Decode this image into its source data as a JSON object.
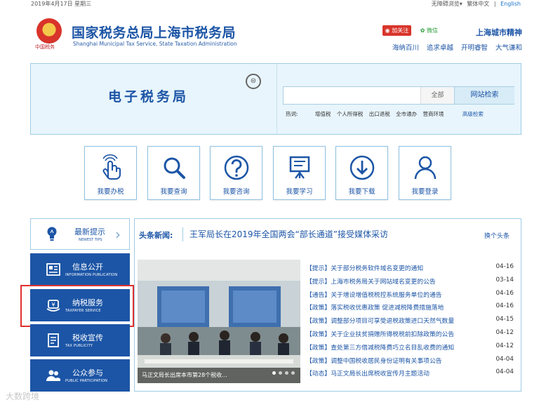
{
  "topbar": {
    "date": "2019年4月17日 星期三",
    "accessibility": "无障碍浏览▾",
    "traditional": "繁体中文",
    "divider": "|",
    "english": "English"
  },
  "header": {
    "title": "国家税务总局上海市税务局",
    "subtitle": "Shanghai Municipal Tax Service, State Taxation Administration",
    "emblem_caption": "中国税务",
    "weibo_label": "加关注",
    "wechat_label": "微信",
    "city_spirit": "上海城市精神",
    "mottos": [
      "海纳百川",
      "追求卓越",
      "开明睿智",
      "大气谦和"
    ]
  },
  "etax": {
    "title": "电子税务局",
    "search_placeholder": "",
    "scope": "全部",
    "search_button": "网站检索",
    "hotwords_label": "热词:",
    "hotwords": [
      "增值税",
      "个人所得税",
      "出口退税",
      "全市通办",
      "营商环境"
    ],
    "advanced": "高级检索"
  },
  "quick_links": [
    {
      "label": "我要办税",
      "icon": "hand-pointer-icon"
    },
    {
      "label": "我要查询",
      "icon": "search-icon"
    },
    {
      "label": "我要咨询",
      "icon": "question-icon"
    },
    {
      "label": "我要学习",
      "icon": "easel-icon"
    },
    {
      "label": "我要下载",
      "icon": "download-icon"
    },
    {
      "label": "我要登录",
      "icon": "user-icon"
    }
  ],
  "sidebar": {
    "newest_title": "最新提示",
    "newest_sub": "NEWEST TIPS",
    "items": [
      {
        "label": "信息公开",
        "sub": "INFORMATION PUBLICATION",
        "icon": "newspaper-icon"
      },
      {
        "label": "纳税服务",
        "sub": "TAXPAYER SERVICE",
        "icon": "service-icon"
      },
      {
        "label": "税收宣传",
        "sub": "TAX PUBLICITY",
        "icon": "document-icon"
      },
      {
        "label": "公众参与",
        "sub": "PUBLIC PARTICIPATION",
        "icon": "people-icon"
      }
    ]
  },
  "news": {
    "headline_label": "头条新闻:",
    "headline_text": "王军局长在2019年全国两会“部长通道”接受媒体采访",
    "swap_label": "换个头条",
    "photo_caption": "马正文局长出席本市第28个税收...",
    "items": [
      {
        "title": "【提示】关于部分税务软件域名变更的通知",
        "date": "04-16"
      },
      {
        "title": "【提示】上海市税务局关于网站域名变更的公告",
        "date": "03-14"
      },
      {
        "title": "【通告】关于增设增值税税控系统服务单位的通告",
        "date": "04-16"
      },
      {
        "title": "【政策】落实税收优惠政策 促进减税降费措施落地",
        "date": "04-16"
      },
      {
        "title": "【政策】调整部分项目可享受退税政策进口天然气数量",
        "date": "04-15"
      },
      {
        "title": "【政策】关于企业扶贫捐赠所得税税前扣除政策的公告",
        "date": "04-12"
      },
      {
        "title": "【政策】查处第三方借减税降费巧立名目乱收费的通知",
        "date": "04-12"
      },
      {
        "title": "【政策】调整中国税收居民身份证明有关事项公告",
        "date": "04-04"
      },
      {
        "title": "【动态】马正文局长出席税收宣传月主题活动",
        "date": "04-04"
      }
    ]
  },
  "watermark": "大数跨境"
}
